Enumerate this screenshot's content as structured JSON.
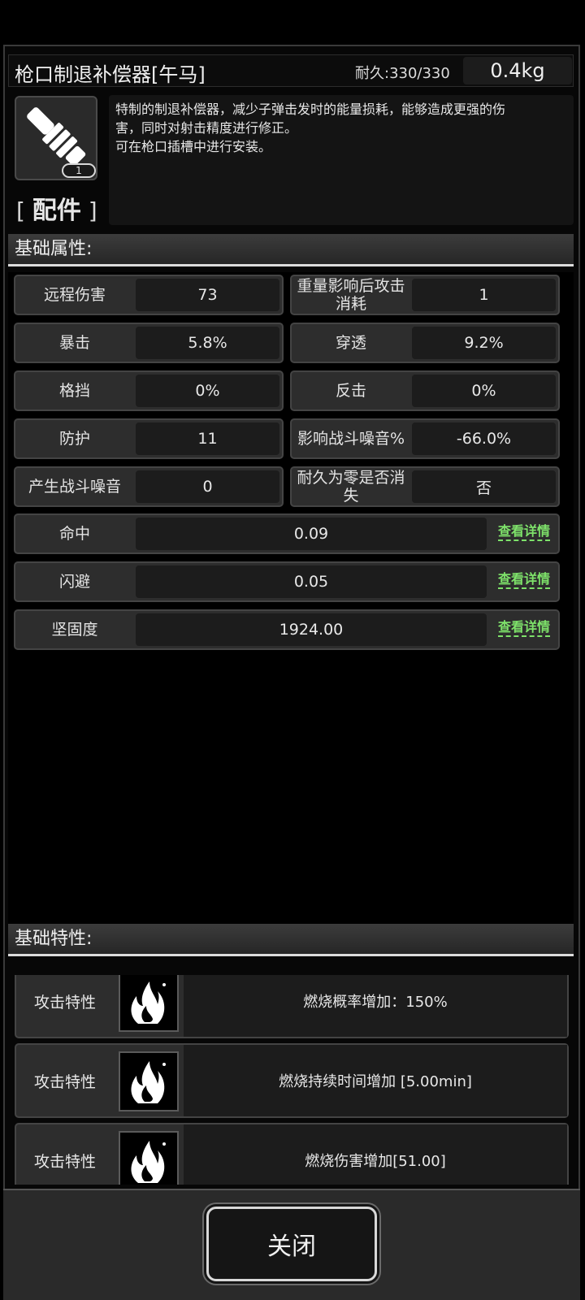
{
  "item": {
    "name": "枪口制退补偿器[午马]",
    "durability": "耐久:330/330",
    "weight": "0.4kg",
    "count": "1",
    "category": "配件",
    "category_open": "[",
    "category_close": "]",
    "description_lines": [
      "特制的制退补偿器，减少子弹击发时的能量损耗，能够造成更强的伤",
      "害，同时对射击精度进行修正。",
      "可在枪口插槽中进行安装。"
    ]
  },
  "sections": {
    "basic_attributes": "基础属性:",
    "basic_traits": "基础特性:"
  },
  "stats": [
    {
      "label": "远程伤害",
      "value": "73"
    },
    {
      "label": "重量影响后攻击消耗",
      "value": "1"
    },
    {
      "label": "暴击",
      "value": "5.8%"
    },
    {
      "label": "穿透",
      "value": "9.2%"
    },
    {
      "label": "格挡",
      "value": "0%"
    },
    {
      "label": "反击",
      "value": "0%"
    },
    {
      "label": "防护",
      "value": "11"
    },
    {
      "label": "影响战斗噪音%",
      "value": "-66.0%"
    },
    {
      "label": "产生战斗噪音",
      "value": "0"
    },
    {
      "label": "耐久为零是否消失",
      "value": "否"
    }
  ],
  "wide_stats": [
    {
      "label": "命中",
      "value": "0.09",
      "link": "查看详情"
    },
    {
      "label": "闪避",
      "value": "0.05",
      "link": "查看详情"
    },
    {
      "label": "坚固度",
      "value": "1924.00",
      "link": "查看详情"
    }
  ],
  "traits": [
    {
      "label": "攻击特性",
      "icon": "fire-icon",
      "text": "燃烧概率增加：150%"
    },
    {
      "label": "攻击特性",
      "icon": "fire-icon",
      "text": "燃烧持续时间增加 [5.00min]"
    },
    {
      "label": "攻击特性",
      "icon": "fire-icon",
      "text": "燃烧伤害增加[51.00]"
    }
  ],
  "footer": {
    "close_label": "关闭"
  }
}
